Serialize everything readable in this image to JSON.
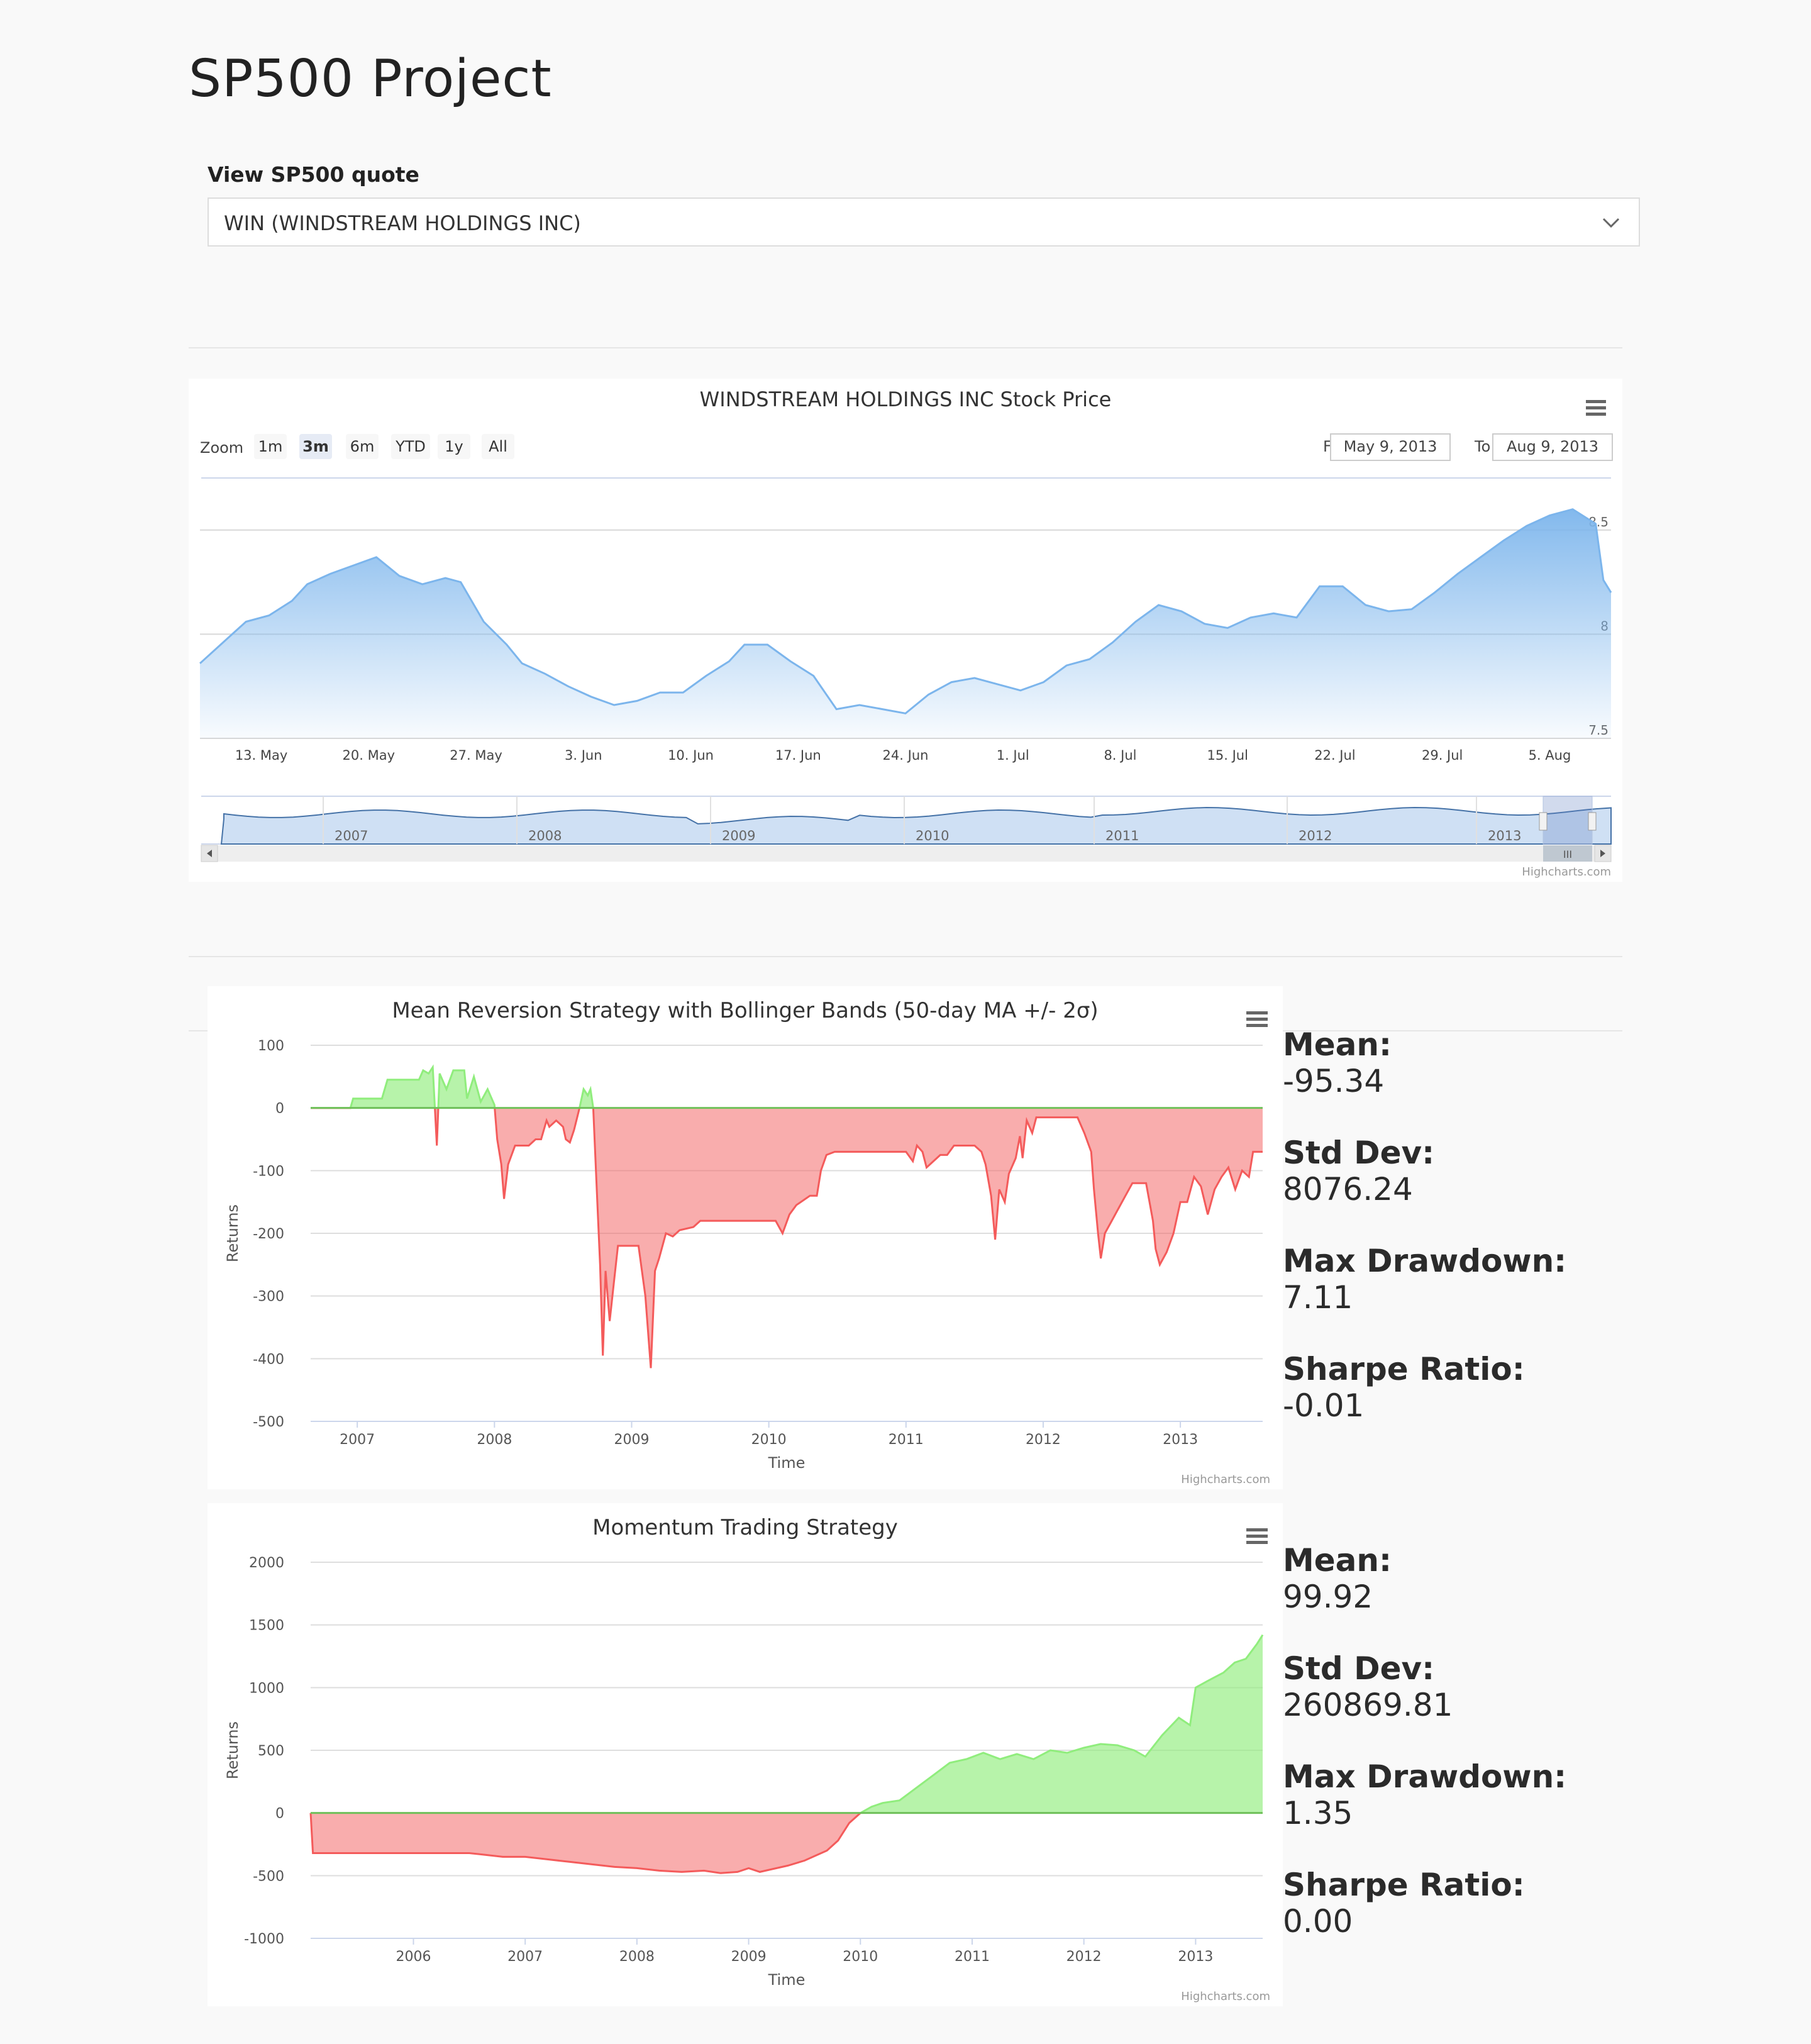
{
  "page": {
    "title": "SP500 Project",
    "quote_label": "View SP500 quote",
    "quote_selected": "WIN (WINDSTREAM HOLDINGS INC)"
  },
  "stock_chart": {
    "title": "WINDSTREAM HOLDINGS INC Stock Price",
    "zoom_label": "Zoom",
    "zoom_buttons": [
      "1m",
      "3m",
      "6m",
      "YTD",
      "1y",
      "All"
    ],
    "zoom_selected": "3m",
    "from_label": "From",
    "from_value": "May 9, 2013",
    "to_label": "To",
    "to_value": "Aug 9, 2013",
    "credit": "Highcharts.com",
    "navigator_years": [
      "2007",
      "2008",
      "2009",
      "2010",
      "2011",
      "2012",
      "2013"
    ],
    "navigator_scroll_grip": "III"
  },
  "strategies": [
    {
      "stats": [
        {
          "label": "Mean:",
          "value": "-95.34"
        },
        {
          "label": "Std Dev:",
          "value": "8076.24"
        },
        {
          "label": "Max Drawdown:",
          "value": "7.11"
        },
        {
          "label": "Sharpe Ratio:",
          "value": "-0.01"
        }
      ],
      "credit": "Highcharts.com"
    },
    {
      "stats": [
        {
          "label": "Mean:",
          "value": "99.92"
        },
        {
          "label": "Std Dev:",
          "value": "260869.81"
        },
        {
          "label": "Max Drawdown:",
          "value": "1.35"
        },
        {
          "label": "Sharpe Ratio:",
          "value": "0.00"
        }
      ],
      "credit": "Highcharts.com"
    }
  ],
  "chart_data": [
    {
      "type": "area",
      "title": "WINDSTREAM HOLDINGS INC Stock Price",
      "x_ticks": [
        "13. May",
        "20. May",
        "27. May",
        "3. Jun",
        "10. Jun",
        "17. Jun",
        "24. Jun",
        "1. Jul",
        "8. Jul",
        "15. Jul",
        "22. Jul",
        "29. Jul",
        "5. Aug"
      ],
      "y_ticks": [
        "7.5",
        "8",
        "8.5"
      ],
      "ylim": [
        7.5,
        8.75
      ],
      "x_range_days": [
        0,
        92
      ],
      "x_tick_days": [
        4,
        11,
        18,
        25,
        32,
        39,
        46,
        53,
        60,
        67,
        74,
        81,
        88
      ],
      "color": "#7cb5ec",
      "points": [
        [
          0,
          7.86
        ],
        [
          1.5,
          7.96
        ],
        [
          3,
          8.06
        ],
        [
          4.5,
          8.09
        ],
        [
          6,
          8.16
        ],
        [
          7,
          8.24
        ],
        [
          8.5,
          8.29
        ],
        [
          10,
          8.33
        ],
        [
          11.5,
          8.37
        ],
        [
          13,
          8.28
        ],
        [
          14.5,
          8.24
        ],
        [
          16,
          8.27
        ],
        [
          17,
          8.25
        ],
        [
          18.5,
          8.06
        ],
        [
          20,
          7.95
        ],
        [
          21,
          7.86
        ],
        [
          22.5,
          7.81
        ],
        [
          24,
          7.75
        ],
        [
          25.5,
          7.7
        ],
        [
          27,
          7.66
        ],
        [
          28.5,
          7.68
        ],
        [
          30,
          7.72
        ],
        [
          31.5,
          7.72
        ],
        [
          33,
          7.8
        ],
        [
          34.5,
          7.87
        ],
        [
          35.5,
          7.95
        ],
        [
          37,
          7.95
        ],
        [
          38.5,
          7.87
        ],
        [
          40,
          7.8
        ],
        [
          41.5,
          7.64
        ],
        [
          43,
          7.66
        ],
        [
          44.5,
          7.64
        ],
        [
          46,
          7.62
        ],
        [
          47.5,
          7.71
        ],
        [
          49,
          7.77
        ],
        [
          50.5,
          7.79
        ],
        [
          52,
          7.76
        ],
        [
          53.5,
          7.73
        ],
        [
          55,
          7.77
        ],
        [
          56.5,
          7.85
        ],
        [
          58,
          7.88
        ],
        [
          59.5,
          7.96
        ],
        [
          61,
          8.06
        ],
        [
          62.5,
          8.14
        ],
        [
          64,
          8.11
        ],
        [
          65.5,
          8.05
        ],
        [
          67,
          8.03
        ],
        [
          68.5,
          8.08
        ],
        [
          70,
          8.1
        ],
        [
          71.5,
          8.08
        ],
        [
          73,
          8.23
        ],
        [
          74.5,
          8.23
        ],
        [
          76,
          8.14
        ],
        [
          77.5,
          8.11
        ],
        [
          79,
          8.12
        ],
        [
          80.5,
          8.2
        ],
        [
          82,
          8.29
        ],
        [
          83.5,
          8.37
        ],
        [
          85,
          8.45
        ],
        [
          86.5,
          8.52
        ],
        [
          88,
          8.57
        ],
        [
          89.5,
          8.6
        ],
        [
          91,
          8.53
        ],
        [
          91.5,
          8.26
        ],
        [
          92,
          8.2
        ]
      ]
    },
    {
      "type": "area",
      "title": "Mean Reversion Strategy with Bollinger Bands (50-day MA +/- 2σ)",
      "xlabel": "Time",
      "ylabel": "Returns",
      "ylim": [
        -500,
        100
      ],
      "y_ticks": [
        "100",
        "0",
        "-100",
        "-200",
        "-300",
        "-400",
        "-500"
      ],
      "x_ticks": [
        "2007",
        "2008",
        "2009",
        "2010",
        "2011",
        "2012",
        "2013"
      ],
      "x_range": [
        2006.66,
        2013.6
      ],
      "positive_color": "#90ed7d",
      "negative_color": "#f45b5b",
      "points": [
        [
          2006.66,
          0
        ],
        [
          2006.95,
          0
        ],
        [
          2006.97,
          15
        ],
        [
          2007.18,
          15
        ],
        [
          2007.22,
          45
        ],
        [
          2007.45,
          45
        ],
        [
          2007.48,
          60
        ],
        [
          2007.52,
          55
        ],
        [
          2007.55,
          65
        ],
        [
          2007.58,
          -60
        ],
        [
          2007.6,
          55
        ],
        [
          2007.65,
          30
        ],
        [
          2007.7,
          60
        ],
        [
          2007.78,
          60
        ],
        [
          2007.8,
          15
        ],
        [
          2007.85,
          50
        ],
        [
          2007.9,
          10
        ],
        [
          2007.95,
          30
        ],
        [
          2008.0,
          5
        ],
        [
          2008.02,
          -50
        ],
        [
          2008.05,
          -90
        ],
        [
          2008.07,
          -145
        ],
        [
          2008.1,
          -90
        ],
        [
          2008.15,
          -60
        ],
        [
          2008.2,
          -60
        ],
        [
          2008.25,
          -60
        ],
        [
          2008.3,
          -50
        ],
        [
          2008.34,
          -50
        ],
        [
          2008.38,
          -20
        ],
        [
          2008.4,
          -30
        ],
        [
          2008.45,
          -20
        ],
        [
          2008.5,
          -30
        ],
        [
          2008.52,
          -50
        ],
        [
          2008.55,
          -55
        ],
        [
          2008.58,
          -35
        ],
        [
          2008.62,
          0
        ],
        [
          2008.65,
          30
        ],
        [
          2008.68,
          20
        ],
        [
          2008.7,
          30
        ],
        [
          2008.72,
          0
        ],
        [
          2008.75,
          -150
        ],
        [
          2008.77,
          -250
        ],
        [
          2008.79,
          -395
        ],
        [
          2008.81,
          -260
        ],
        [
          2008.84,
          -340
        ],
        [
          2008.87,
          -280
        ],
        [
          2008.9,
          -220
        ],
        [
          2009.0,
          -220
        ],
        [
          2009.05,
          -220
        ],
        [
          2009.1,
          -300
        ],
        [
          2009.14,
          -415
        ],
        [
          2009.17,
          -260
        ],
        [
          2009.2,
          -240
        ],
        [
          2009.25,
          -200
        ],
        [
          2009.3,
          -205
        ],
        [
          2009.35,
          -195
        ],
        [
          2009.45,
          -190
        ],
        [
          2009.5,
          -180
        ],
        [
          2009.6,
          -180
        ],
        [
          2009.7,
          -180
        ],
        [
          2009.75,
          -180
        ],
        [
          2009.8,
          -180
        ],
        [
          2009.95,
          -180
        ],
        [
          2010.05,
          -180
        ],
        [
          2010.1,
          -200
        ],
        [
          2010.15,
          -170
        ],
        [
          2010.2,
          -155
        ],
        [
          2010.3,
          -140
        ],
        [
          2010.35,
          -140
        ],
        [
          2010.38,
          -100
        ],
        [
          2010.42,
          -75
        ],
        [
          2010.48,
          -70
        ],
        [
          2010.55,
          -70
        ],
        [
          2010.7,
          -70
        ],
        [
          2010.9,
          -70
        ],
        [
          2011.0,
          -70
        ],
        [
          2011.05,
          -85
        ],
        [
          2011.08,
          -60
        ],
        [
          2011.12,
          -70
        ],
        [
          2011.15,
          -95
        ],
        [
          2011.2,
          -85
        ],
        [
          2011.25,
          -75
        ],
        [
          2011.3,
          -75
        ],
        [
          2011.35,
          -60
        ],
        [
          2011.4,
          -60
        ],
        [
          2011.5,
          -60
        ],
        [
          2011.55,
          -70
        ],
        [
          2011.58,
          -90
        ],
        [
          2011.62,
          -140
        ],
        [
          2011.65,
          -210
        ],
        [
          2011.68,
          -130
        ],
        [
          2011.72,
          -150
        ],
        [
          2011.75,
          -105
        ],
        [
          2011.8,
          -80
        ],
        [
          2011.83,
          -45
        ],
        [
          2011.85,
          -80
        ],
        [
          2011.88,
          -20
        ],
        [
          2011.92,
          -40
        ],
        [
          2011.95,
          -15
        ],
        [
          2012.0,
          -15
        ],
        [
          2012.15,
          -15
        ],
        [
          2012.2,
          -15
        ],
        [
          2012.25,
          -15
        ],
        [
          2012.3,
          -40
        ],
        [
          2012.35,
          -70
        ],
        [
          2012.37,
          -130
        ],
        [
          2012.4,
          -200
        ],
        [
          2012.42,
          -240
        ],
        [
          2012.45,
          -200
        ],
        [
          2012.5,
          -180
        ],
        [
          2012.55,
          -160
        ],
        [
          2012.6,
          -140
        ],
        [
          2012.65,
          -120
        ],
        [
          2012.75,
          -120
        ],
        [
          2012.8,
          -180
        ],
        [
          2012.82,
          -225
        ],
        [
          2012.85,
          -250
        ],
        [
          2012.9,
          -230
        ],
        [
          2012.95,
          -200
        ],
        [
          2013.0,
          -150
        ],
        [
          2013.05,
          -150
        ],
        [
          2013.1,
          -110
        ],
        [
          2013.15,
          -125
        ],
        [
          2013.2,
          -170
        ],
        [
          2013.25,
          -130
        ],
        [
          2013.3,
          -110
        ],
        [
          2013.35,
          -95
        ],
        [
          2013.4,
          -130
        ],
        [
          2013.45,
          -100
        ],
        [
          2013.5,
          -110
        ],
        [
          2013.53,
          -70
        ],
        [
          2013.6,
          -70
        ]
      ]
    },
    {
      "type": "area",
      "title": "Momentum Trading Strategy",
      "xlabel": "Time",
      "ylabel": "Returns",
      "ylim": [
        -1000,
        2000
      ],
      "y_ticks": [
        "2000",
        "1500",
        "1000",
        "500",
        "0",
        "-500",
        "-1000"
      ],
      "x_ticks": [
        "2006",
        "2007",
        "2008",
        "2009",
        "2010",
        "2011",
        "2012",
        "2013"
      ],
      "x_range": [
        2005.08,
        2013.6
      ],
      "positive_color": "#90ed7d",
      "negative_color": "#f45b5b",
      "points": [
        [
          2005.08,
          0
        ],
        [
          2005.1,
          -320
        ],
        [
          2005.5,
          -320
        ],
        [
          2006.0,
          -320
        ],
        [
          2006.5,
          -320
        ],
        [
          2006.6,
          -330
        ],
        [
          2006.8,
          -350
        ],
        [
          2007.0,
          -350
        ],
        [
          2007.2,
          -370
        ],
        [
          2007.4,
          -390
        ],
        [
          2007.6,
          -410
        ],
        [
          2007.8,
          -430
        ],
        [
          2008.0,
          -440
        ],
        [
          2008.2,
          -460
        ],
        [
          2008.4,
          -470
        ],
        [
          2008.6,
          -460
        ],
        [
          2008.75,
          -480
        ],
        [
          2008.9,
          -470
        ],
        [
          2009.0,
          -440
        ],
        [
          2009.1,
          -470
        ],
        [
          2009.2,
          -450
        ],
        [
          2009.35,
          -420
        ],
        [
          2009.5,
          -380
        ],
        [
          2009.6,
          -340
        ],
        [
          2009.7,
          -300
        ],
        [
          2009.8,
          -220
        ],
        [
          2009.9,
          -80
        ],
        [
          2010.0,
          0
        ],
        [
          2010.1,
          50
        ],
        [
          2010.2,
          80
        ],
        [
          2010.35,
          100
        ],
        [
          2010.5,
          200
        ],
        [
          2010.65,
          300
        ],
        [
          2010.8,
          400
        ],
        [
          2010.95,
          430
        ],
        [
          2011.1,
          480
        ],
        [
          2011.25,
          430
        ],
        [
          2011.4,
          470
        ],
        [
          2011.55,
          430
        ],
        [
          2011.7,
          500
        ],
        [
          2011.85,
          480
        ],
        [
          2012.0,
          520
        ],
        [
          2012.15,
          550
        ],
        [
          2012.3,
          540
        ],
        [
          2012.45,
          500
        ],
        [
          2012.55,
          450
        ],
        [
          2012.7,
          620
        ],
        [
          2012.85,
          760
        ],
        [
          2012.95,
          700
        ],
        [
          2013.0,
          1000
        ],
        [
          2013.1,
          1050
        ],
        [
          2013.25,
          1120
        ],
        [
          2013.35,
          1200
        ],
        [
          2013.45,
          1230
        ],
        [
          2013.55,
          1350
        ],
        [
          2013.6,
          1420
        ]
      ]
    }
  ]
}
